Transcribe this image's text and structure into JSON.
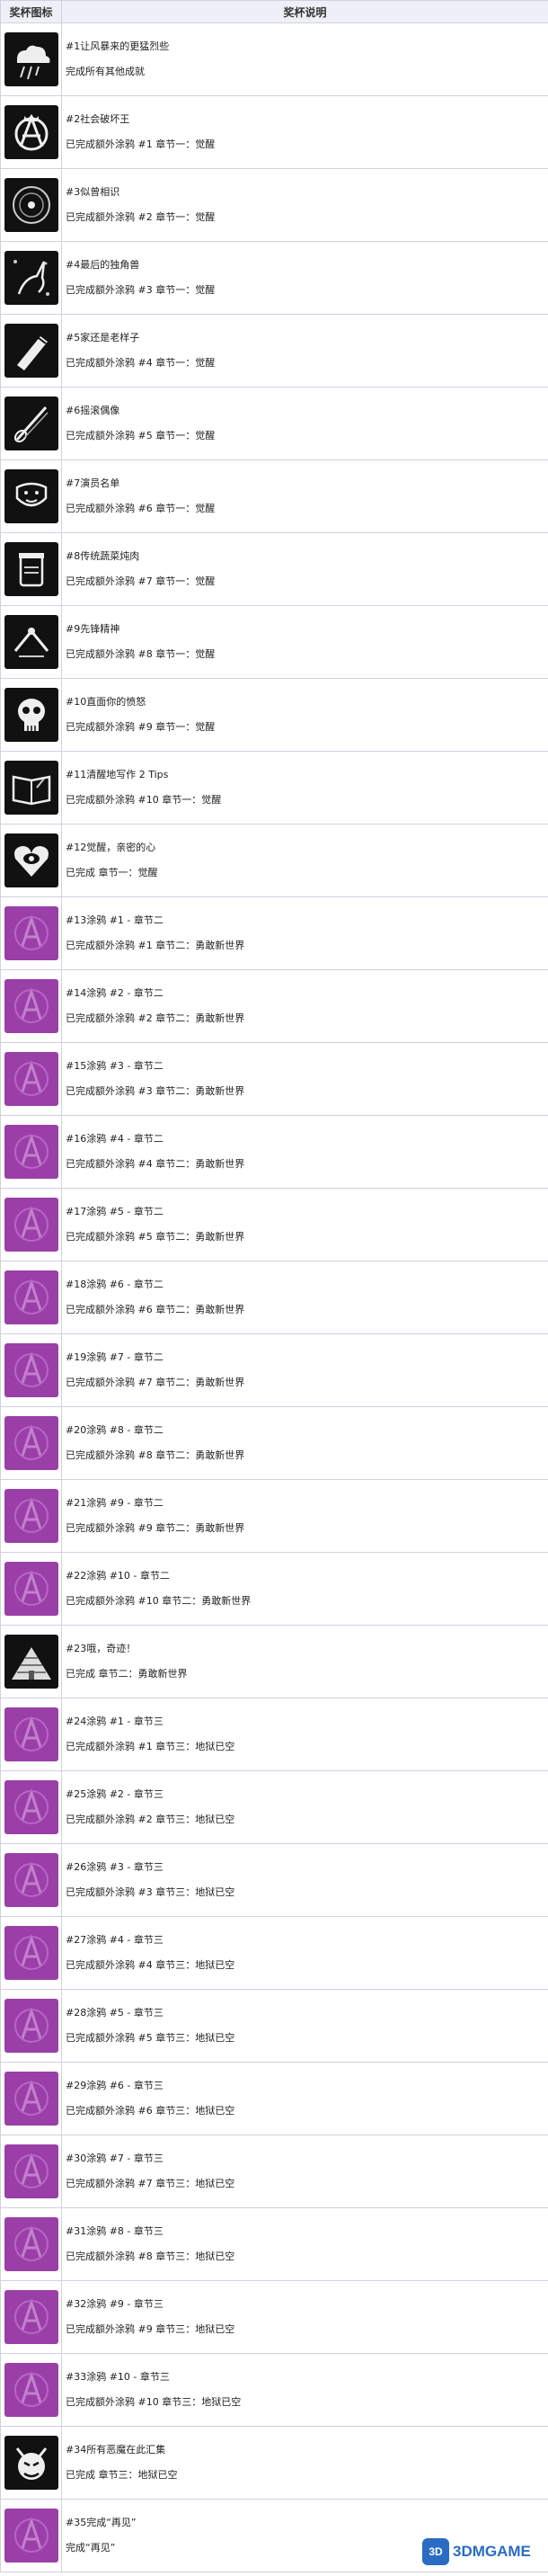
{
  "table": {
    "header": {
      "icon_col": "奖杯图标",
      "desc_col": "奖杯说明"
    },
    "rows": [
      {
        "icon": "cloud-storm-icon",
        "name": "#1让风暴来的更猛烈些",
        "cond": "完成所有其他成就"
      },
      {
        "icon": "anarchy-king-icon",
        "name": "#2社会破坏王",
        "cond": "已完成额外涂鸦 #1 章节一：觉醒"
      },
      {
        "icon": "disc-icon",
        "name": "#3似曾相识",
        "cond": "已完成额外涂鸦 #2 章节一：觉醒"
      },
      {
        "icon": "unicorn-icon",
        "name": "#4最后的独角兽",
        "cond": "已完成额外涂鸦 #3 章节一：觉醒"
      },
      {
        "icon": "old-guy-icon",
        "name": "#5家还是老样子",
        "cond": "已完成额外涂鸦 #4 章节一：觉醒"
      },
      {
        "icon": "guitar-icon",
        "name": "#6摇滚偶像",
        "cond": "已完成额外涂鸦 #5 章节一：觉醒"
      },
      {
        "icon": "actor-list-icon",
        "name": "#7演员名单",
        "cond": "已完成额外涂鸦 #6 章节一：觉醒"
      },
      {
        "icon": "food-jar-icon",
        "name": "#8传统蔬菜炖肉",
        "cond": "已完成额外涂鸦 #7 章节一：觉醒"
      },
      {
        "icon": "pioneer-icon",
        "name": "#9先锋精神",
        "cond": "已完成额外涂鸦 #8 章节一：觉醒"
      },
      {
        "icon": "skull-icon",
        "name": "#10直面你的愤怒",
        "cond": "已完成额外涂鸦 #9 章节一：觉醒"
      },
      {
        "icon": "book-icon",
        "name": "#11清醒地写作 2 Tips",
        "cond": "已完成额外涂鸦 #10 章节一：觉醒"
      },
      {
        "icon": "heart-eye-icon",
        "name": "#12觉醒，亲密的心",
        "cond": "已完成 章节一：觉醒"
      },
      {
        "icon": "graffiti-purple-icon",
        "name": "#13涂鸦 #1 - 章节二",
        "cond": "已完成额外涂鸦 #1 章节二：勇敢新世界"
      },
      {
        "icon": "graffiti-purple-icon",
        "name": "#14涂鸦 #2 - 章节二",
        "cond": "已完成额外涂鸦 #2 章节二：勇敢新世界"
      },
      {
        "icon": "graffiti-purple-icon",
        "name": "#15涂鸦 #3 - 章节二",
        "cond": "已完成额外涂鸦 #3 章节二：勇敢新世界"
      },
      {
        "icon": "graffiti-purple-icon",
        "name": "#16涂鸦 #4 - 章节二",
        "cond": "已完成额外涂鸦 #4 章节二：勇敢新世界"
      },
      {
        "icon": "graffiti-purple-icon",
        "name": "#17涂鸦 #5 - 章节二",
        "cond": "已完成额外涂鸦 #5 章节二：勇敢新世界"
      },
      {
        "icon": "graffiti-purple-icon",
        "name": "#18涂鸦 #6 - 章节二",
        "cond": "已完成额外涂鸦 #6 章节二：勇敢新世界"
      },
      {
        "icon": "graffiti-purple-icon",
        "name": "#19涂鸦 #7 - 章节二",
        "cond": "已完成额外涂鸦 #7 章节二：勇敢新世界"
      },
      {
        "icon": "graffiti-purple-icon",
        "name": "#20涂鸦 #8 - 章节二",
        "cond": "已完成额外涂鸦 #8 章节二：勇敢新世界"
      },
      {
        "icon": "graffiti-purple-icon",
        "name": "#21涂鸦 #9 - 章节二",
        "cond": "已完成额外涂鸦 #9 章节二：勇敢新世界"
      },
      {
        "icon": "graffiti-purple-icon",
        "name": "#22涂鸦 #10 - 章节二",
        "cond": "已完成额外涂鸦 #10 章节二：勇敢新世界"
      },
      {
        "icon": "pyramid-icon",
        "name": "#23哦，奇迹！",
        "cond": "已完成 章节二：勇敢新世界"
      },
      {
        "icon": "graffiti-purple-icon",
        "name": "#24涂鸦 #1 - 章节三",
        "cond": "已完成额外涂鸦 #1 章节三：地狱已空"
      },
      {
        "icon": "graffiti-purple-icon",
        "name": "#25涂鸦 #2 - 章节三",
        "cond": "已完成额外涂鸦 #2 章节三：地狱已空"
      },
      {
        "icon": "graffiti-purple-icon",
        "name": "#26涂鸦 #3 - 章节三",
        "cond": "已完成额外涂鸦 #3 章节三：地狱已空"
      },
      {
        "icon": "graffiti-purple-icon",
        "name": "#27涂鸦 #4 - 章节三",
        "cond": "已完成额外涂鸦 #4 章节三：地狱已空"
      },
      {
        "icon": "graffiti-purple-icon",
        "name": "#28涂鸦 #5 - 章节三",
        "cond": "已完成额外涂鸦 #5 章节三：地狱已空"
      },
      {
        "icon": "graffiti-purple-icon",
        "name": "#29涂鸦 #6 - 章节三",
        "cond": "已完成额外涂鸦 #6 章节三：地狱已空"
      },
      {
        "icon": "graffiti-purple-icon",
        "name": "#30涂鸦 #7 - 章节三",
        "cond": "已完成额外涂鸦 #7 章节三：地狱已空"
      },
      {
        "icon": "graffiti-purple-icon",
        "name": "#31涂鸦 #8 - 章节三",
        "cond": "已完成额外涂鸦 #8 章节三：地狱已空"
      },
      {
        "icon": "graffiti-purple-icon",
        "name": "#32涂鸦 #9 - 章节三",
        "cond": "已完成额外涂鸦 #9 章节三：地狱已空"
      },
      {
        "icon": "graffiti-purple-icon",
        "name": "#33涂鸦 #10 - 章节三",
        "cond": "已完成额外涂鸦 #10 章节三：地狱已空"
      },
      {
        "icon": "devil-face-icon",
        "name": "#34所有恶魔在此汇集",
        "cond": "已完成 章节三：地狱已空"
      },
      {
        "icon": "graffiti-purple-icon",
        "name": "#35完成“再见”",
        "cond": "完成“再见”"
      }
    ]
  },
  "watermark": {
    "badge": "3D",
    "text": "3DMGAME"
  },
  "colors": {
    "purple": "#9a3fa8",
    "dark": "#111111",
    "header_bg": "#eef0f7",
    "border": "#cfd3df"
  }
}
